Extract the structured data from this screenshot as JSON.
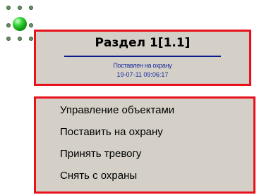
{
  "object_icon": {
    "name": "green-ball-icon",
    "color": "#18b018"
  },
  "info_panel": {
    "title": "Раздел 1[1.1]",
    "status": "Поставлен на охрану",
    "timestamp": "19-07-11 09:06:17",
    "border_color": "#e8121c",
    "text_color": "#1a2a9a"
  },
  "context_menu": {
    "items": [
      {
        "label": "Управление объектами"
      },
      {
        "label": "Поставить на охрану"
      },
      {
        "label": "Принять тревогу"
      },
      {
        "label": "Снять с охраны"
      }
    ]
  }
}
